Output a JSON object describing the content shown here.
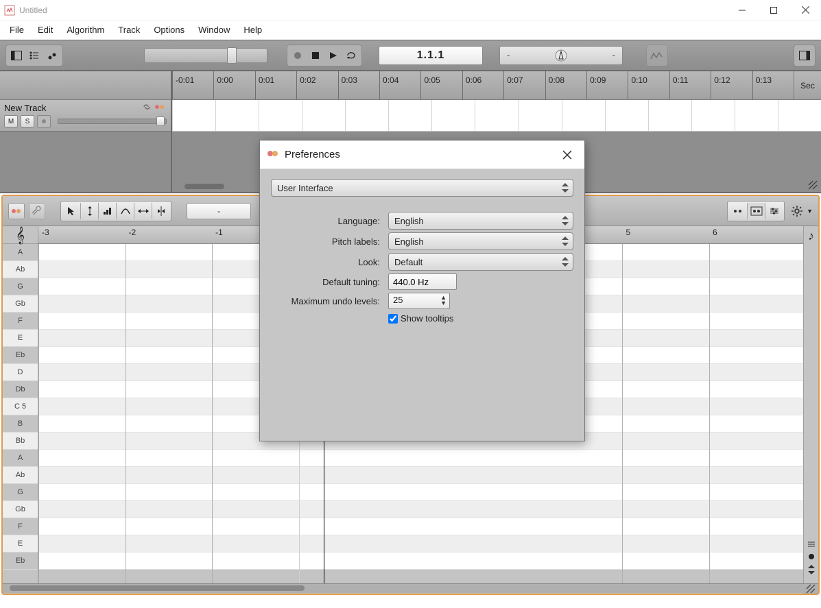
{
  "window": {
    "title": "Untitled"
  },
  "menu": {
    "items": [
      "File",
      "Edit",
      "Algorithm",
      "Track",
      "Options",
      "Window",
      "Help"
    ]
  },
  "transport": {
    "position": "1.1.1",
    "tempo_left": "-",
    "tempo_right": "-"
  },
  "timeline": {
    "ticks": [
      "-0:01",
      "0:00",
      "0:01",
      "0:02",
      "0:03",
      "0:04",
      "0:05",
      "0:06",
      "0:07",
      "0:08",
      "0:09",
      "0:10",
      "0:11",
      "0:12",
      "0:13"
    ],
    "unit": "Sec"
  },
  "track": {
    "name": "New Track",
    "mute": "M",
    "solo": "S"
  },
  "editor": {
    "zoom": "-",
    "ruler": [
      "-3",
      "-2",
      "-1",
      "",
      "5",
      "6"
    ],
    "notes": [
      "A",
      "Ab",
      "G",
      "Gb",
      "F",
      "E",
      "Eb",
      "D",
      "Db",
      "C 5",
      "B",
      "Bb",
      "A",
      "Ab",
      "G",
      "Gb",
      "F",
      "E",
      "Eb"
    ]
  },
  "dialog": {
    "title": "Preferences",
    "section": "User Interface",
    "labels": {
      "language": "Language:",
      "pitch": "Pitch labels:",
      "look": "Look:",
      "tuning": "Default tuning:",
      "undo": "Maximum undo levels:",
      "tooltips": "Show tooltips"
    },
    "values": {
      "language": "English",
      "pitch": "English",
      "look": "Default",
      "tuning": "440.0 Hz",
      "undo": "25"
    }
  }
}
